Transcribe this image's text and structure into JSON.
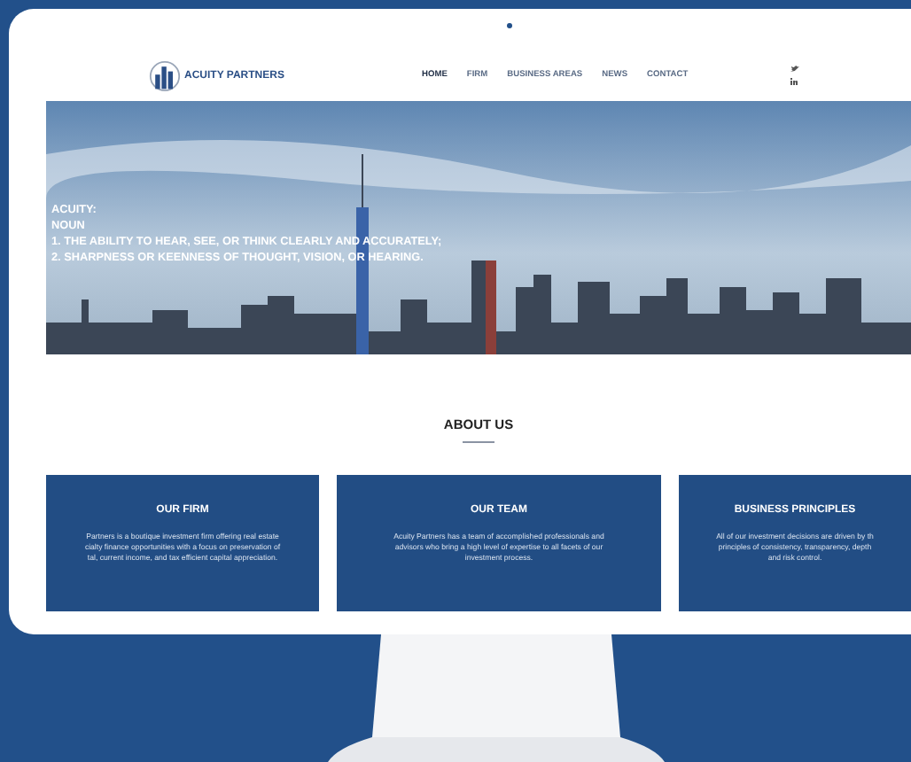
{
  "header": {
    "logo_text": "ACUITY PARTNERS",
    "nav": [
      {
        "label": "HOME",
        "selected": true
      },
      {
        "label": "FIRM",
        "selected": false
      },
      {
        "label": "BUSINESS AREAS",
        "selected": false
      },
      {
        "label": "NEWS",
        "selected": false
      },
      {
        "label": "CONTACT",
        "selected": false
      }
    ]
  },
  "hero": {
    "lines": [
      "ACUITY:",
      "NOUN",
      "1. THE ABILITY TO HEAR, SEE, OR THINK CLEARLY AND ACCURATELY;",
      "2. SHARPNESS OR KEENNESS OF THOUGHT, VISION, OR HEARING."
    ]
  },
  "about": {
    "heading": "ABOUT US"
  },
  "cards": [
    {
      "title": "OUR FIRM",
      "lines": [
        "Partners is a boutique investment firm offering real estate",
        "cialty finance opportunities with a focus on preservation of",
        "tal, current income, and tax efficient capital appreciation."
      ]
    },
    {
      "title": "OUR TEAM",
      "lines": [
        "Acuity Partners has a team of accomplished professionals and",
        "advisors who bring a high level of expertise to all facets of our",
        "investment process."
      ]
    },
    {
      "title": "BUSINESS PRINCIPLES",
      "lines": [
        "All of our investment decisions are driven by th",
        "principles of consistency, transparency, depth",
        "and risk control."
      ]
    }
  ]
}
